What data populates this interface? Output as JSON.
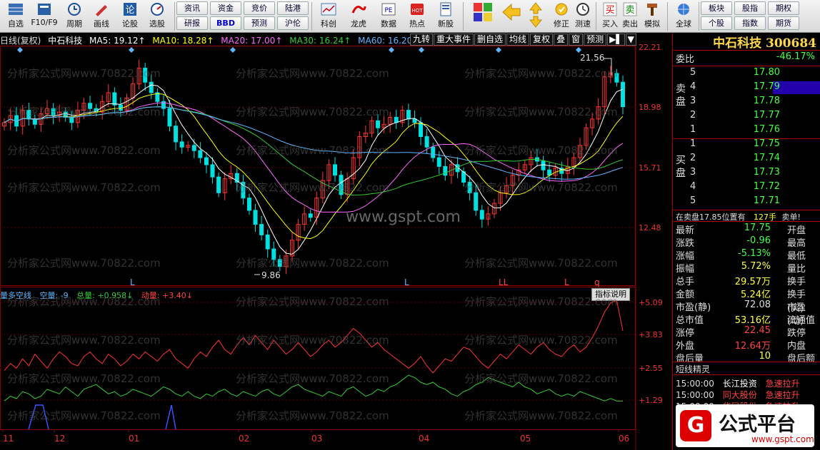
{
  "toolbar": {
    "big_buttons": [
      {
        "label": "自选",
        "icon": "grid-icon"
      },
      {
        "label": "F10/F9",
        "icon": "f10-icon"
      },
      {
        "label": "周期",
        "icon": "clock-icon"
      },
      {
        "label": "画线",
        "icon": "pencil-icon"
      },
      {
        "label": "论股",
        "icon": "lun-icon"
      },
      {
        "label": "选股",
        "icon": "gauge-icon"
      }
    ],
    "small_buttons": [
      "资讯",
      "资金",
      "竞价",
      "陆港",
      "研报",
      "BBD",
      "预测",
      "沪伦"
    ],
    "big_buttons2": [
      {
        "label": "科创",
        "icon": "kechuang-icon"
      },
      {
        "label": "龙虎",
        "icon": "dragon-icon"
      },
      {
        "label": "数据",
        "icon": "pe-icon"
      },
      {
        "label": "热点",
        "icon": "hot-icon"
      },
      {
        "label": "新股",
        "icon": "newstock-icon"
      }
    ],
    "tools": [
      {
        "label": "",
        "icon": "color-squares-icon"
      },
      {
        "label": "",
        "icon": "left-arrow-icon"
      },
      {
        "label": "",
        "icon": "up-down-arrows-icon"
      },
      {
        "label": "修正",
        "icon": "fix-icon"
      },
      {
        "label": "测速",
        "icon": "speed-icon"
      },
      {
        "label": "买入",
        "icon": "buy-icon"
      },
      {
        "label": "卖出",
        "icon": "sell-icon"
      },
      {
        "label": "模拟",
        "icon": "hammer-icon"
      },
      {
        "label": "全球",
        "icon": "globe-icon"
      }
    ],
    "right_buttons": [
      "板块",
      "股指",
      "期权",
      "个股",
      "指数",
      "期货"
    ],
    "tool_glyphs": {
      "buy": "买",
      "sell": "卖"
    }
  },
  "chart": {
    "ma_header": {
      "period": "日线(复权)",
      "name": "中石科技",
      "ma5": "MA5: 19.12↑",
      "ma10": "MA10: 18.28↑",
      "ma20": "MA20: 17.00↑",
      "ma30": "MA30: 16.24↑",
      "ma60": "MA60: 16.20↓"
    },
    "func_buttons": [
      "九转",
      "重大事件",
      "删自选",
      "均线",
      "复权",
      "叠",
      "窗",
      "预测"
    ],
    "y_axis_main": [
      "22.21",
      "18.98",
      "15.71",
      "12.48"
    ],
    "y_axis_sub": [
      "+5.09",
      "+3.83",
      "+2.55",
      "+1.29"
    ],
    "high_label": "21.56",
    "low_label": "9.86",
    "markers": [
      "L",
      "L",
      "LL",
      "L",
      "q"
    ],
    "sub_header": {
      "name": "量多空线",
      "a": "空量: -9",
      "b": "总量: +0.958↓",
      "c": "动量: +3.40↓"
    },
    "zhibiao_button": "指标说明",
    "x_labels": [
      "11",
      "12",
      "01",
      "02",
      "03",
      "04",
      "05",
      "06"
    ],
    "watermark": "分析家公式网www.70822.com",
    "site_watermark": "www.gspt.com"
  },
  "chart_data": {
    "type": "candlestick",
    "ylim": [
      9.5,
      22.5
    ],
    "closes": [
      18.2,
      18.6,
      18.0,
      18.9,
      18.4,
      18.1,
      18.7,
      19.0,
      18.6,
      18.8,
      18.5,
      18.2,
      18.9,
      19.3,
      19.0,
      18.8,
      19.4,
      19.9,
      19.2,
      18.9,
      19.6,
      20.4,
      21.3,
      20.5,
      19.9,
      19.4,
      19.0,
      18.0,
      17.1,
      16.8,
      16.9,
      16.6,
      16.2,
      15.8,
      15.1,
      14.2,
      15.0,
      15.3,
      14.8,
      13.9,
      13.2,
      12.4,
      11.8,
      11.0,
      10.4,
      10.0,
      10.6,
      11.5,
      12.4,
      13.0,
      12.8,
      13.9,
      14.9,
      15.8,
      15.2,
      14.1,
      15.0,
      16.2,
      17.4,
      17.6,
      18.3,
      17.9,
      18.1,
      18.5,
      18.2,
      18.9,
      18.4,
      18.2,
      17.4,
      16.8,
      16.2,
      15.7,
      15.2,
      15.8,
      15.4,
      14.8,
      14.2,
      13.2,
      12.7,
      13.0,
      13.6,
      14.2,
      14.6,
      15.2,
      15.5,
      15.8,
      16.2,
      16.0,
      15.5,
      15.2,
      15.6,
      15.3,
      15.7,
      16.2,
      16.9,
      17.9,
      18.4,
      19.1,
      20.8,
      21.0,
      20.5,
      19.1
    ],
    "y_values_series": {
      "ma5": "derived",
      "ma10": "derived",
      "ma20": "derived",
      "ma30": "derived",
      "ma60": "derived"
    },
    "indicator_total": [
      0.8,
      1.0,
      0.9,
      1.2,
      1.1,
      0.9,
      1.0,
      1.3,
      1.2,
      1.1,
      1.4,
      1.2,
      1.0,
      1.3,
      1.4,
      1.5,
      1.3,
      1.1,
      1.2,
      1.0,
      1.1,
      1.3,
      1.2,
      1.1,
      1.0,
      1.2,
      1.4,
      1.3,
      1.1,
      1.0,
      1.2,
      1.0,
      0.9,
      1.1,
      1.0,
      1.2,
      1.3,
      1.1,
      1.0,
      1.2,
      1.1,
      1.0,
      1.2,
      1.3,
      1.1,
      1.0,
      1.2,
      1.4,
      1.5,
      1.3,
      1.2,
      1.1,
      1.0,
      1.2,
      1.1,
      1.0,
      1.3,
      1.4,
      1.2,
      1.0,
      1.1,
      1.3,
      1.2,
      1.4,
      1.5,
      1.7,
      1.9,
      1.8,
      1.6,
      1.5,
      1.6,
      1.4,
      1.3,
      1.1,
      1.0,
      1.2,
      1.3,
      1.5,
      1.6,
      1.8,
      1.7,
      1.6,
      1.5,
      1.4,
      1.6,
      1.4,
      1.3,
      1.1,
      1.2,
      1.3,
      1.1,
      1.0,
      1.1,
      1.0,
      1.2,
      1.1,
      1.0,
      0.9,
      0.8,
      0.9,
      0.8,
      0.8
    ],
    "indicator_momentum": [
      2.1,
      2.4,
      2.2,
      2.6,
      2.3,
      2.8,
      2.5,
      2.2,
      2.6,
      2.9,
      2.7,
      2.4,
      2.3,
      2.7,
      2.9,
      2.6,
      2.4,
      2.8,
      2.6,
      2.3,
      2.5,
      2.8,
      2.6,
      2.9,
      2.7,
      2.5,
      2.8,
      3.0,
      2.6,
      2.4,
      2.2,
      2.6,
      2.9,
      2.7,
      3.1,
      3.4,
      3.0,
      2.8,
      3.2,
      3.5,
      3.2,
      3.6,
      3.3,
      3.0,
      3.4,
      3.1,
      2.8,
      3.0,
      3.3,
      3.0,
      2.7,
      2.9,
      3.2,
      3.4,
      3.1,
      3.3,
      3.6,
      3.9,
      3.7,
      3.4,
      3.1,
      3.3,
      3.0,
      2.8,
      2.6,
      2.4,
      2.2,
      2.4,
      2.7,
      2.3,
      2.0,
      2.3,
      2.6,
      2.5,
      2.8,
      3.1,
      3.0,
      2.7,
      2.4,
      2.2,
      2.5,
      2.8,
      2.6,
      2.9,
      3.2,
      3.0,
      2.8,
      3.1,
      3.3,
      3.0,
      2.8,
      2.7,
      3.0,
      3.2,
      2.9,
      3.1,
      3.5,
      4.0,
      4.6,
      5.0,
      5.1,
      3.8
    ]
  },
  "quote": {
    "title": "中石科技 300684",
    "weibi_label": "委比",
    "weibi_value": "-46.17%",
    "sell_label": "卖盘",
    "buy_label": "买盘",
    "sell_book": [
      {
        "lvl": "5",
        "px": "17.80"
      },
      {
        "lvl": "4",
        "px": "17.79"
      },
      {
        "lvl": "3",
        "px": "17.78"
      },
      {
        "lvl": "2",
        "px": "17.77"
      },
      {
        "lvl": "1",
        "px": "17.76"
      }
    ],
    "buy_book": [
      {
        "lvl": "1",
        "px": "17.75"
      },
      {
        "lvl": "2",
        "px": "17.74"
      },
      {
        "lvl": "3",
        "px": "17.73"
      },
      {
        "lvl": "4",
        "px": "17.72"
      },
      {
        "lvl": "5",
        "px": "17.71"
      }
    ],
    "notice": "在卖盘17.85位置有",
    "notice_qty": "127手",
    "notice_tail": "卖单!",
    "stats": [
      {
        "k": "最新",
        "v": "17.75",
        "k2": "开盘",
        "color": "#4f4"
      },
      {
        "k": "涨跌",
        "v": "-0.96",
        "k2": "最高",
        "color": "#4f4"
      },
      {
        "k": "涨幅",
        "v": "-5.13%",
        "k2": "最低",
        "color": "#4f4"
      },
      {
        "k": "振幅",
        "v": "5.72%",
        "k2": "量比",
        "color": "#ff4"
      },
      {
        "k": "总手",
        "v": "29.57万",
        "k2": "换手",
        "color": "#ff4"
      },
      {
        "k": "金额",
        "v": "5.24亿",
        "k2": "换手(实)",
        "color": "#ff4"
      },
      {
        "k": "市盈(静)",
        "v": "72.08",
        "k2": "市盈(动)",
        "color": "#ddd"
      },
      {
        "k": "总市值",
        "v": "53.16亿",
        "k2": "流通值",
        "color": "#ff4"
      },
      {
        "k": "涨停",
        "v": "22.45",
        "k2": "跌停",
        "color": "#f44"
      },
      {
        "k": "外盘",
        "v": "12.64万",
        "k2": "内盘",
        "color": "#f44"
      },
      {
        "k": "盘后量",
        "v": "10",
        "k2": "盘后额",
        "color": "#ff4"
      }
    ],
    "short_title": "短线精灵",
    "short_rows": [
      {
        "time": "15:00:00",
        "name": "长江投资",
        "event": "急速拉升"
      },
      {
        "time": "15:00:00",
        "name": "同大股份",
        "event": "急速拉升"
      },
      {
        "time": "15:00:00",
        "name": "华民股份",
        "event": "急速拉升"
      }
    ]
  },
  "logo": {
    "glyph": "G",
    "title": "公式平台",
    "url": "www.gspt.com"
  },
  "colors": {
    "up": "#ff3333",
    "down": "#00e0e0",
    "ma5": "#ffffff",
    "ma10": "#ffff00",
    "ma20": "#ff66ff",
    "ma30": "#33cc33",
    "ma60": "#5fb6ff"
  }
}
